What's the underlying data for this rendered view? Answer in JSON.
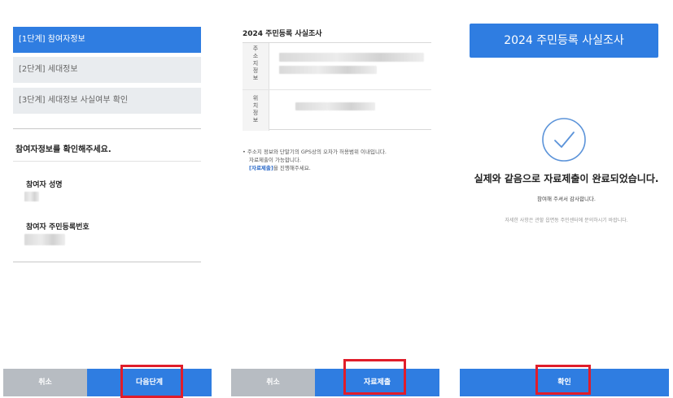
{
  "panel1": {
    "steps": [
      "[1단계] 참여자정보",
      "[2단계] 세대정보",
      "[3단계] 세대정보 사실여부 확인"
    ],
    "heading": "참여자정보를 확인해주세요.",
    "name_label": "참여자 성명",
    "rrn_label": "참여자 주민등록번호",
    "cancel": "취소",
    "next": "다음단계"
  },
  "panel2": {
    "title": "2024 주민등록 사실조사",
    "rows": [
      {
        "label": "주\n소\n지\n정\n보"
      },
      {
        "label": "위\n치\n정\n보"
      }
    ],
    "note_line1": "• 주소지 정보와 단말기의 GPS상의 오차가 허용범위 이내입니다.",
    "note_line2": "자료제출이 가능합니다.",
    "note_link": "[자료제출]",
    "note_line3": "을 진행해주세요.",
    "cancel": "취소",
    "submit": "자료제출"
  },
  "panel3": {
    "title": "2024 주민등록 사실조사",
    "done_message": "실제와 같음으로 자료제출이 완료되었습니다.",
    "thanks": "참여해 주셔서 감사합니다.",
    "inquire": "자세한 사항은 관할 읍면동 주민센터에 문의하시기 바랍니다.",
    "confirm": "확인"
  },
  "colors": {
    "primary": "#2f7de1",
    "highlight": "#e01d2a",
    "cancel_bg": "#b7bcc2"
  },
  "icons": {
    "complete": "check-circle-icon"
  }
}
